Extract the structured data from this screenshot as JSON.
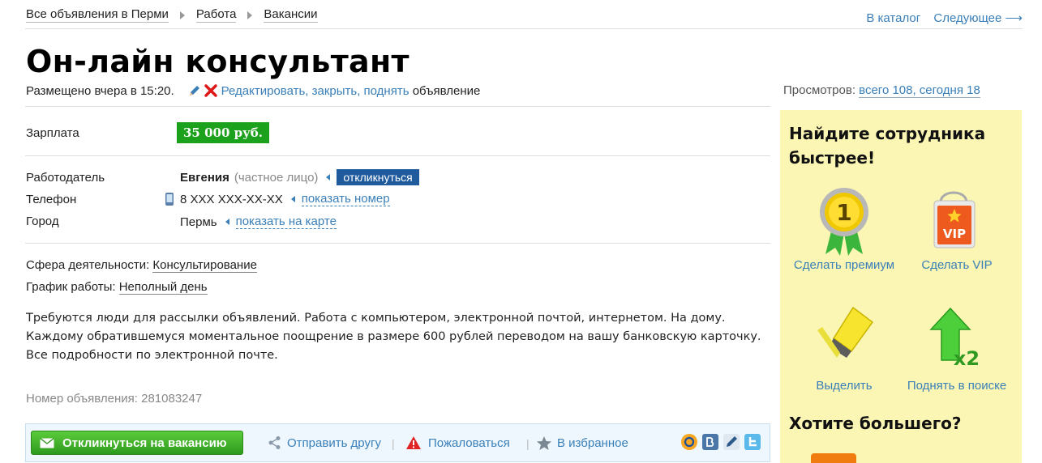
{
  "breadcrumbs": [
    "Все объявления в Перми",
    "Работа",
    "Вакансии"
  ],
  "topnav": {
    "catalog": "В каталог",
    "next": "Следующее ⟶"
  },
  "ad": {
    "title": "Он-лайн консультант",
    "posted": "Размещено вчера в 15:20.",
    "edit_link": "Редактировать, закрыть, поднять",
    "edit_suffix": " объявление",
    "views_label": "Просмотров: ",
    "views_link": "всего 108, сегодня 18",
    "salary_label": "Зарплата",
    "salary": "35 000 руб.",
    "employer_label": "Работодатель",
    "employer_name": "Евгения",
    "employer_type": "(частное лицо)",
    "respond_small": "откликнуться",
    "phone_label": "Телефон",
    "phone": "8 XXX XXX-XX-XX",
    "show_phone": "показать номер",
    "city_label": "Город",
    "city": "Пермь",
    "show_map": "показать на карте",
    "sphere_label": "Сфера деятельности: ",
    "sphere": "Консультирование",
    "schedule_label": "График работы: ",
    "schedule": "Неполный день",
    "description": [
      "Требуются люди для рассылки объявлений. Работа с компьютером, электронной почтой, интернетом. На дому.",
      "Каждому обратившемуся моментальное поощрение в размере 600 рублей переводом на вашу банковскую карточку.",
      "Все подробности по электронной почте."
    ],
    "ad_number": "Номер объявления: 281083247"
  },
  "actions": {
    "respond": "Откликнуться на вакансию",
    "send_friend": "Отправить другу",
    "complain": "Пожаловаться",
    "favorite": "В избранное"
  },
  "sidebar": {
    "heading": [
      "Найдите сотрудника",
      "быстрее!"
    ],
    "premium": "Сделать премиум",
    "vip": "Сделать VIP",
    "vip_badge": "VIP",
    "medal_number": "1",
    "highlight": "Выделить",
    "raise": "Поднять в поиске",
    "raise_badge": "x2",
    "more": "Хотите большего?"
  },
  "colors": {
    "link": "#3a7fb8",
    "salary_bg": "#1ca11c",
    "sidebar_bg": "#fcf6b4",
    "respond_btn": "#2e9a1e"
  }
}
